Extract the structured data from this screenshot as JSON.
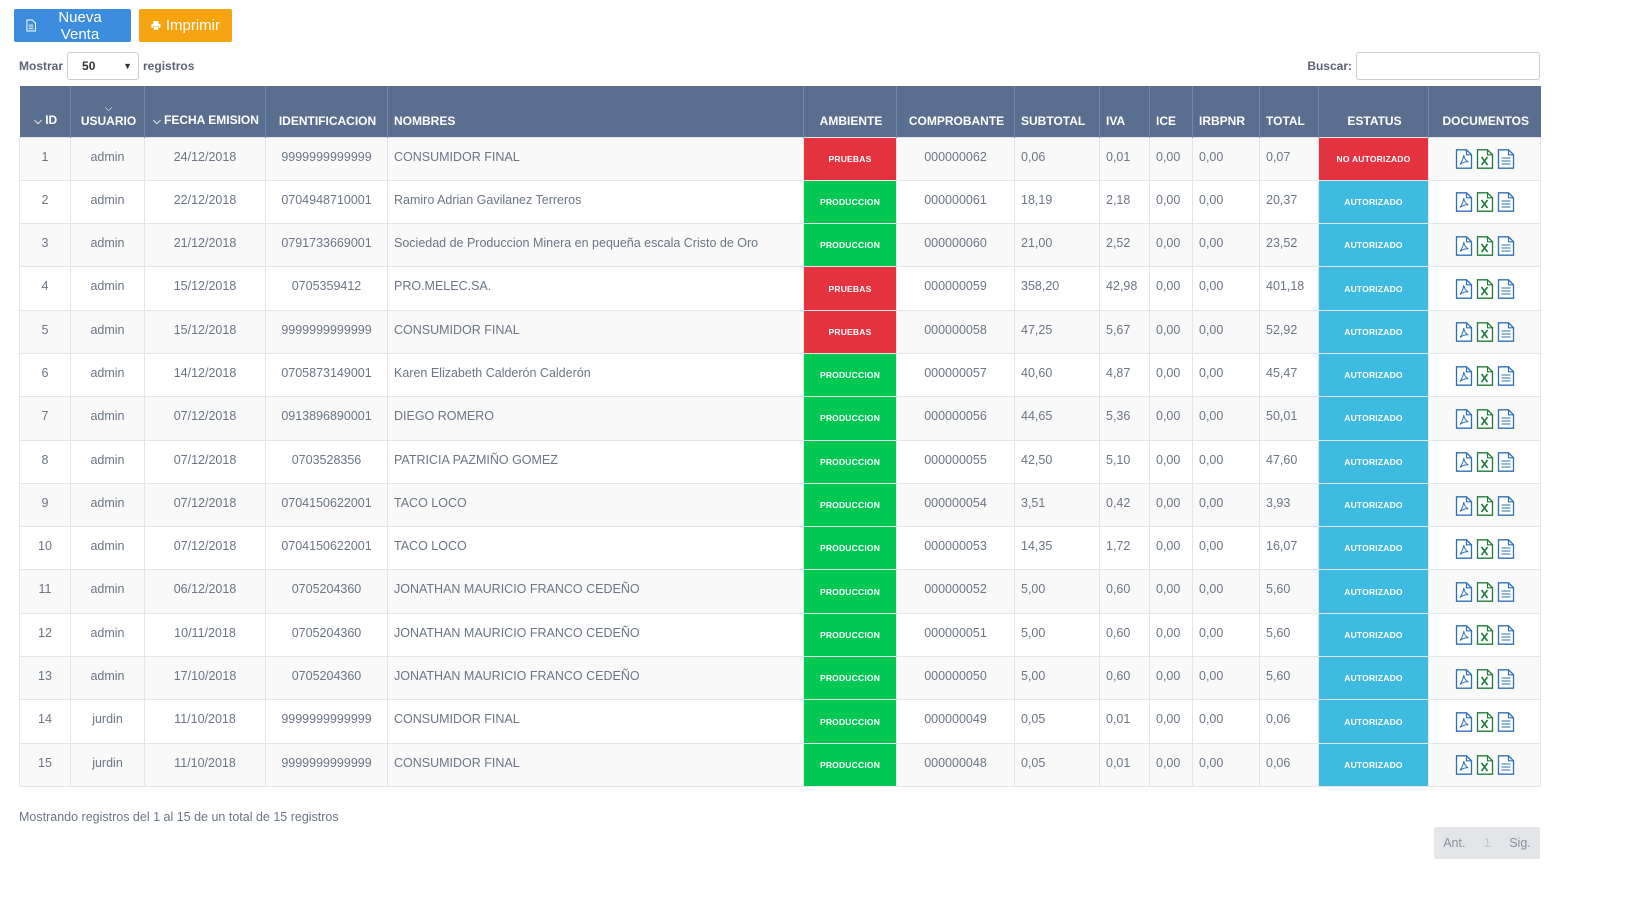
{
  "toolbar": {
    "new_sale_label": "Nueva Venta",
    "print_label": "Imprimir"
  },
  "length": {
    "show_label": "Mostrar",
    "selected": "50",
    "records_label": "registros"
  },
  "search": {
    "label": "Buscar:",
    "value": ""
  },
  "table": {
    "headers": {
      "id": "ID",
      "usuario": "USUARIO",
      "fecha": "FECHA EMISION",
      "identificacion": "IDENTIFICACION",
      "nombres": "NOMBRES",
      "ambiente": "AMBIENTE",
      "comprobante": "COMPROBANTE",
      "subtotal": "SUBTOTAL",
      "iva": "IVA",
      "ice": "ICE",
      "irbpnr": "IRBPNR",
      "total": "TOTAL",
      "estatus": "ESTATUS",
      "documentos": "DOCUMENTOS"
    },
    "rows": [
      {
        "id": "1",
        "usuario": "admin",
        "fecha": "24/12/2018",
        "identificacion": "9999999999999",
        "nombres": "CONSUMIDOR FINAL",
        "ambiente": "PRUEBAS",
        "comprobante": "000000062",
        "subtotal": "0,06",
        "iva": "0,01",
        "ice": "0,00",
        "irbpnr": "0,00",
        "total": "0,07",
        "estatus": "NO AUTORIZADO"
      },
      {
        "id": "2",
        "usuario": "admin",
        "fecha": "22/12/2018",
        "identificacion": "0704948710001",
        "nombres": "Ramiro Adrian Gavilanez Terreros",
        "ambiente": "PRODUCCION",
        "comprobante": "000000061",
        "subtotal": "18,19",
        "iva": "2,18",
        "ice": "0,00",
        "irbpnr": "0,00",
        "total": "20,37",
        "estatus": "AUTORIZADO"
      },
      {
        "id": "3",
        "usuario": "admin",
        "fecha": "21/12/2018",
        "identificacion": "0791733669001",
        "nombres": "Sociedad de Produccion Minera en pequeña escala Cristo de Oro",
        "ambiente": "PRODUCCION",
        "comprobante": "000000060",
        "subtotal": "21,00",
        "iva": "2,52",
        "ice": "0,00",
        "irbpnr": "0,00",
        "total": "23,52",
        "estatus": "AUTORIZADO"
      },
      {
        "id": "4",
        "usuario": "admin",
        "fecha": "15/12/2018",
        "identificacion": "0705359412",
        "nombres": "PRO.MELEC.SA.",
        "ambiente": "PRUEBAS",
        "comprobante": "000000059",
        "subtotal": "358,20",
        "iva": "42,98",
        "ice": "0,00",
        "irbpnr": "0,00",
        "total": "401,18",
        "estatus": "AUTORIZADO"
      },
      {
        "id": "5",
        "usuario": "admin",
        "fecha": "15/12/2018",
        "identificacion": "9999999999999",
        "nombres": "CONSUMIDOR FINAL",
        "ambiente": "PRUEBAS",
        "comprobante": "000000058",
        "subtotal": "47,25",
        "iva": "5,67",
        "ice": "0,00",
        "irbpnr": "0,00",
        "total": "52,92",
        "estatus": "AUTORIZADO"
      },
      {
        "id": "6",
        "usuario": "admin",
        "fecha": "14/12/2018",
        "identificacion": "0705873149001",
        "nombres": "Karen Elizabeth Calderón Calderón",
        "ambiente": "PRODUCCION",
        "comprobante": "000000057",
        "subtotal": "40,60",
        "iva": "4,87",
        "ice": "0,00",
        "irbpnr": "0,00",
        "total": "45,47",
        "estatus": "AUTORIZADO"
      },
      {
        "id": "7",
        "usuario": "admin",
        "fecha": "07/12/2018",
        "identificacion": "0913896890001",
        "nombres": "DIEGO ROMERO",
        "ambiente": "PRODUCCION",
        "comprobante": "000000056",
        "subtotal": "44,65",
        "iva": "5,36",
        "ice": "0,00",
        "irbpnr": "0,00",
        "total": "50,01",
        "estatus": "AUTORIZADO"
      },
      {
        "id": "8",
        "usuario": "admin",
        "fecha": "07/12/2018",
        "identificacion": "0703528356",
        "nombres": "PATRICIA PAZMIÑO GOMEZ",
        "ambiente": "PRODUCCION",
        "comprobante": "000000055",
        "subtotal": "42,50",
        "iva": "5,10",
        "ice": "0,00",
        "irbpnr": "0,00",
        "total": "47,60",
        "estatus": "AUTORIZADO"
      },
      {
        "id": "9",
        "usuario": "admin",
        "fecha": "07/12/2018",
        "identificacion": "0704150622001",
        "nombres": "TACO LOCO",
        "ambiente": "PRODUCCION",
        "comprobante": "000000054",
        "subtotal": "3,51",
        "iva": "0,42",
        "ice": "0,00",
        "irbpnr": "0,00",
        "total": "3,93",
        "estatus": "AUTORIZADO"
      },
      {
        "id": "10",
        "usuario": "admin",
        "fecha": "07/12/2018",
        "identificacion": "0704150622001",
        "nombres": "TACO LOCO",
        "ambiente": "PRODUCCION",
        "comprobante": "000000053",
        "subtotal": "14,35",
        "iva": "1,72",
        "ice": "0,00",
        "irbpnr": "0,00",
        "total": "16,07",
        "estatus": "AUTORIZADO"
      },
      {
        "id": "11",
        "usuario": "admin",
        "fecha": "06/12/2018",
        "identificacion": "0705204360",
        "nombres": "JONATHAN MAURICIO FRANCO CEDEÑO",
        "ambiente": "PRODUCCION",
        "comprobante": "000000052",
        "subtotal": "5,00",
        "iva": "0,60",
        "ice": "0,00",
        "irbpnr": "0,00",
        "total": "5,60",
        "estatus": "AUTORIZADO"
      },
      {
        "id": "12",
        "usuario": "admin",
        "fecha": "10/11/2018",
        "identificacion": "0705204360",
        "nombres": "JONATHAN MAURICIO FRANCO CEDEÑO",
        "ambiente": "PRODUCCION",
        "comprobante": "000000051",
        "subtotal": "5,00",
        "iva": "0,60",
        "ice": "0,00",
        "irbpnr": "0,00",
        "total": "5,60",
        "estatus": "AUTORIZADO"
      },
      {
        "id": "13",
        "usuario": "admin",
        "fecha": "17/10/2018",
        "identificacion": "0705204360",
        "nombres": "JONATHAN MAURICIO FRANCO CEDEÑO",
        "ambiente": "PRODUCCION",
        "comprobante": "000000050",
        "subtotal": "5,00",
        "iva": "0,60",
        "ice": "0,00",
        "irbpnr": "0,00",
        "total": "5,60",
        "estatus": "AUTORIZADO"
      },
      {
        "id": "14",
        "usuario": "jurdin",
        "fecha": "11/10/2018",
        "identificacion": "9999999999999",
        "nombres": "CONSUMIDOR FINAL",
        "ambiente": "PRODUCCION",
        "comprobante": "000000049",
        "subtotal": "0,05",
        "iva": "0,01",
        "ice": "0,00",
        "irbpnr": "0,00",
        "total": "0,06",
        "estatus": "AUTORIZADO"
      },
      {
        "id": "15",
        "usuario": "jurdin",
        "fecha": "11/10/2018",
        "identificacion": "9999999999999",
        "nombres": "CONSUMIDOR FINAL",
        "ambiente": "PRODUCCION",
        "comprobante": "000000048",
        "subtotal": "0,05",
        "iva": "0,01",
        "ice": "0,00",
        "irbpnr": "0,00",
        "total": "0,06",
        "estatus": "AUTORIZADO"
      }
    ]
  },
  "badge_colors": {
    "PRUEBAS": "#e5323f",
    "PRODUCCION": "#00c853",
    "NO AUTORIZADO": "#e5323f",
    "AUTORIZADO": "#3dbbe0"
  },
  "doc_icons": [
    "pdf-icon",
    "excel-icon",
    "xml-icon"
  ],
  "footer": {
    "info": "Mostrando registros del 1 al 15 de un total de 15 registros"
  },
  "pager": {
    "prev": "Ant.",
    "current": "1",
    "next": "Sig."
  }
}
